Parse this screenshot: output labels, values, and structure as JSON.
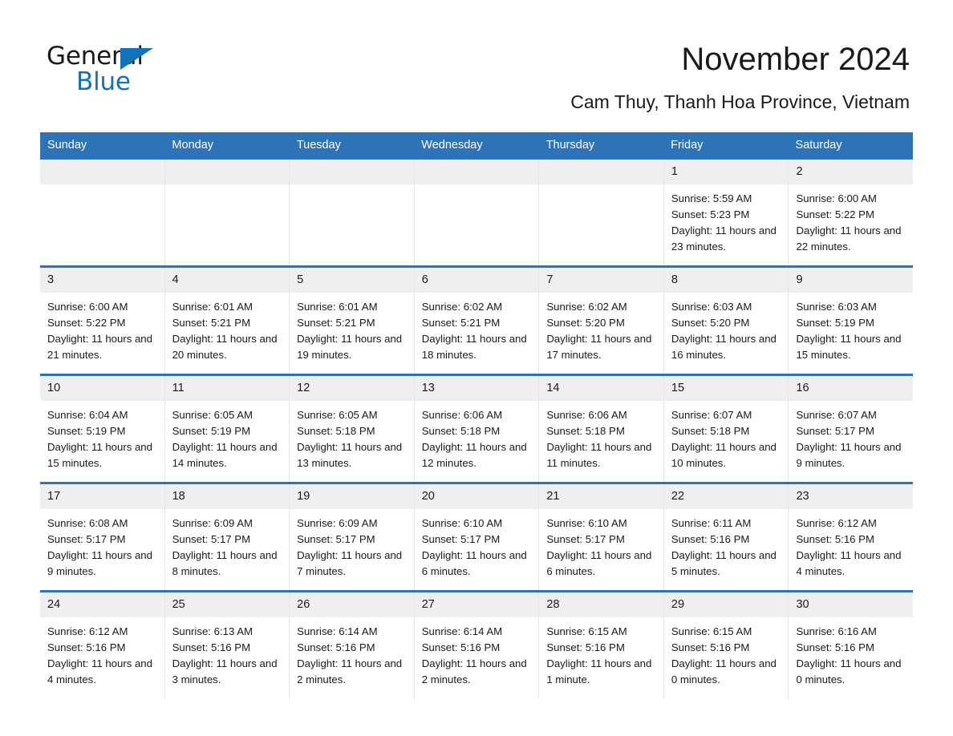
{
  "brand": {
    "name_dark": "General",
    "name_blue": "Blue",
    "accent_color": "#1273ba"
  },
  "header": {
    "month_title": "November 2024",
    "location": "Cam Thuy, Thanh Hoa Province, Vietnam"
  },
  "theme": {
    "header_blue": "#2e72b8",
    "day_strip_gray": "#efefef",
    "text_color": "#1a1a1a"
  },
  "calendar": {
    "weekdays": [
      "Sunday",
      "Monday",
      "Tuesday",
      "Wednesday",
      "Thursday",
      "Friday",
      "Saturday"
    ],
    "weeks": [
      [
        {
          "day": "",
          "sunrise": "",
          "sunset": "",
          "daylight": ""
        },
        {
          "day": "",
          "sunrise": "",
          "sunset": "",
          "daylight": ""
        },
        {
          "day": "",
          "sunrise": "",
          "sunset": "",
          "daylight": ""
        },
        {
          "day": "",
          "sunrise": "",
          "sunset": "",
          "daylight": ""
        },
        {
          "day": "",
          "sunrise": "",
          "sunset": "",
          "daylight": ""
        },
        {
          "day": "1",
          "sunrise": "Sunrise: 5:59 AM",
          "sunset": "Sunset: 5:23 PM",
          "daylight": "Daylight: 11 hours and 23 minutes."
        },
        {
          "day": "2",
          "sunrise": "Sunrise: 6:00 AM",
          "sunset": "Sunset: 5:22 PM",
          "daylight": "Daylight: 11 hours and 22 minutes."
        }
      ],
      [
        {
          "day": "3",
          "sunrise": "Sunrise: 6:00 AM",
          "sunset": "Sunset: 5:22 PM",
          "daylight": "Daylight: 11 hours and 21 minutes."
        },
        {
          "day": "4",
          "sunrise": "Sunrise: 6:01 AM",
          "sunset": "Sunset: 5:21 PM",
          "daylight": "Daylight: 11 hours and 20 minutes."
        },
        {
          "day": "5",
          "sunrise": "Sunrise: 6:01 AM",
          "sunset": "Sunset: 5:21 PM",
          "daylight": "Daylight: 11 hours and 19 minutes."
        },
        {
          "day": "6",
          "sunrise": "Sunrise: 6:02 AM",
          "sunset": "Sunset: 5:21 PM",
          "daylight": "Daylight: 11 hours and 18 minutes."
        },
        {
          "day": "7",
          "sunrise": "Sunrise: 6:02 AM",
          "sunset": "Sunset: 5:20 PM",
          "daylight": "Daylight: 11 hours and 17 minutes."
        },
        {
          "day": "8",
          "sunrise": "Sunrise: 6:03 AM",
          "sunset": "Sunset: 5:20 PM",
          "daylight": "Daylight: 11 hours and 16 minutes."
        },
        {
          "day": "9",
          "sunrise": "Sunrise: 6:03 AM",
          "sunset": "Sunset: 5:19 PM",
          "daylight": "Daylight: 11 hours and 15 minutes."
        }
      ],
      [
        {
          "day": "10",
          "sunrise": "Sunrise: 6:04 AM",
          "sunset": "Sunset: 5:19 PM",
          "daylight": "Daylight: 11 hours and 15 minutes."
        },
        {
          "day": "11",
          "sunrise": "Sunrise: 6:05 AM",
          "sunset": "Sunset: 5:19 PM",
          "daylight": "Daylight: 11 hours and 14 minutes."
        },
        {
          "day": "12",
          "sunrise": "Sunrise: 6:05 AM",
          "sunset": "Sunset: 5:18 PM",
          "daylight": "Daylight: 11 hours and 13 minutes."
        },
        {
          "day": "13",
          "sunrise": "Sunrise: 6:06 AM",
          "sunset": "Sunset: 5:18 PM",
          "daylight": "Daylight: 11 hours and 12 minutes."
        },
        {
          "day": "14",
          "sunrise": "Sunrise: 6:06 AM",
          "sunset": "Sunset: 5:18 PM",
          "daylight": "Daylight: 11 hours and 11 minutes."
        },
        {
          "day": "15",
          "sunrise": "Sunrise: 6:07 AM",
          "sunset": "Sunset: 5:18 PM",
          "daylight": "Daylight: 11 hours and 10 minutes."
        },
        {
          "day": "16",
          "sunrise": "Sunrise: 6:07 AM",
          "sunset": "Sunset: 5:17 PM",
          "daylight": "Daylight: 11 hours and 9 minutes."
        }
      ],
      [
        {
          "day": "17",
          "sunrise": "Sunrise: 6:08 AM",
          "sunset": "Sunset: 5:17 PM",
          "daylight": "Daylight: 11 hours and 9 minutes."
        },
        {
          "day": "18",
          "sunrise": "Sunrise: 6:09 AM",
          "sunset": "Sunset: 5:17 PM",
          "daylight": "Daylight: 11 hours and 8 minutes."
        },
        {
          "day": "19",
          "sunrise": "Sunrise: 6:09 AM",
          "sunset": "Sunset: 5:17 PM",
          "daylight": "Daylight: 11 hours and 7 minutes."
        },
        {
          "day": "20",
          "sunrise": "Sunrise: 6:10 AM",
          "sunset": "Sunset: 5:17 PM",
          "daylight": "Daylight: 11 hours and 6 minutes."
        },
        {
          "day": "21",
          "sunrise": "Sunrise: 6:10 AM",
          "sunset": "Sunset: 5:17 PM",
          "daylight": "Daylight: 11 hours and 6 minutes."
        },
        {
          "day": "22",
          "sunrise": "Sunrise: 6:11 AM",
          "sunset": "Sunset: 5:16 PM",
          "daylight": "Daylight: 11 hours and 5 minutes."
        },
        {
          "day": "23",
          "sunrise": "Sunrise: 6:12 AM",
          "sunset": "Sunset: 5:16 PM",
          "daylight": "Daylight: 11 hours and 4 minutes."
        }
      ],
      [
        {
          "day": "24",
          "sunrise": "Sunrise: 6:12 AM",
          "sunset": "Sunset: 5:16 PM",
          "daylight": "Daylight: 11 hours and 4 minutes."
        },
        {
          "day": "25",
          "sunrise": "Sunrise: 6:13 AM",
          "sunset": "Sunset: 5:16 PM",
          "daylight": "Daylight: 11 hours and 3 minutes."
        },
        {
          "day": "26",
          "sunrise": "Sunrise: 6:14 AM",
          "sunset": "Sunset: 5:16 PM",
          "daylight": "Daylight: 11 hours and 2 minutes."
        },
        {
          "day": "27",
          "sunrise": "Sunrise: 6:14 AM",
          "sunset": "Sunset: 5:16 PM",
          "daylight": "Daylight: 11 hours and 2 minutes."
        },
        {
          "day": "28",
          "sunrise": "Sunrise: 6:15 AM",
          "sunset": "Sunset: 5:16 PM",
          "daylight": "Daylight: 11 hours and 1 minute."
        },
        {
          "day": "29",
          "sunrise": "Sunrise: 6:15 AM",
          "sunset": "Sunset: 5:16 PM",
          "daylight": "Daylight: 11 hours and 0 minutes."
        },
        {
          "day": "30",
          "sunrise": "Sunrise: 6:16 AM",
          "sunset": "Sunset: 5:16 PM",
          "daylight": "Daylight: 11 hours and 0 minutes."
        }
      ]
    ]
  }
}
